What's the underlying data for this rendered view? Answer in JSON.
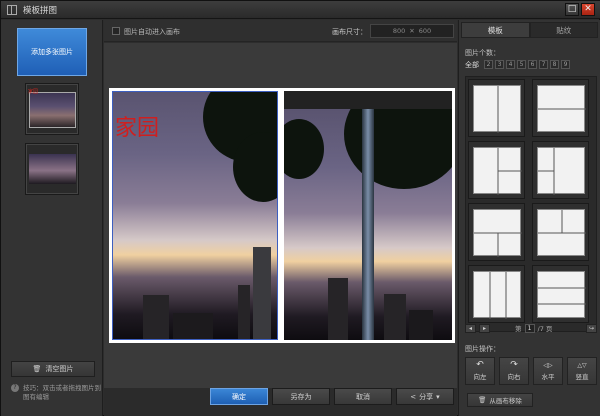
{
  "window": {
    "title": "模板拼图",
    "max_glyph": "□",
    "close_glyph": "✕"
  },
  "left": {
    "add_button": "添加多张图片",
    "thumb1_overlay": "家园",
    "clear_button": "清空图片",
    "tip": "技巧：双击或者拖拽图片到图有编辑"
  },
  "top": {
    "auto_fill_label": "图片自动进入画布",
    "canvas_size_label": "画布尺寸：",
    "width": "800",
    "times": "✕",
    "height": "600"
  },
  "canvas": {
    "overlay_text": "家园"
  },
  "bottom": {
    "confirm": "确定",
    "save_as": "另存为",
    "cancel": "取消",
    "share": "分享"
  },
  "right": {
    "tabs": [
      {
        "label": "模板"
      },
      {
        "label": "贴纹"
      }
    ],
    "count_label": "图片个数：",
    "count_all": "全部",
    "counts": [
      "2",
      "3",
      "4",
      "5",
      "6",
      "7",
      "8",
      "9"
    ],
    "pager": {
      "prefix": "第",
      "page": "1",
      "suffix": "/7 页"
    },
    "ops_label": "图片操作：",
    "ops": [
      {
        "icon": "↶",
        "label": "向左"
      },
      {
        "icon": "↷",
        "label": "向右"
      },
      {
        "icon": "◁▷",
        "label": "水平"
      },
      {
        "icon": "△▽",
        "label": "竖直"
      }
    ],
    "remove_button": "从画布移除"
  },
  "colors": {
    "accent": "#2a6fc6",
    "close": "#c0331c",
    "overlay_text": "#cf1f1f"
  }
}
